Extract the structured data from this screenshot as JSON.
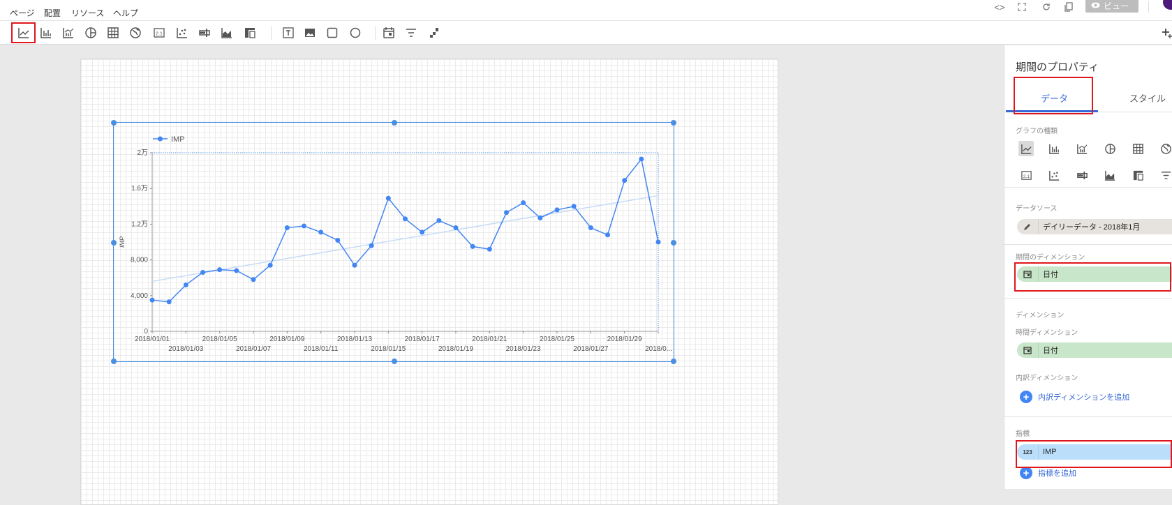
{
  "menu": [
    "ページ",
    "配置",
    "リソース",
    "ヘルプ"
  ],
  "top_icons": [
    "code-icon",
    "fullscreen-icon",
    "refresh-icon",
    "copy-icon"
  ],
  "view_button": "ビュー",
  "toolbar": {
    "chart_tools": [
      "time-series-icon",
      "bar-chart-icon",
      "combo-chart-icon",
      "pie-chart-icon",
      "table-icon",
      "geo-map-icon",
      "scorecard-icon",
      "scatter-icon",
      "bullet-icon",
      "area-chart-icon",
      "pivot-icon"
    ],
    "insert_tools": [
      "text-icon",
      "image-icon",
      "rectangle-icon",
      "circle-icon"
    ],
    "control_tools": [
      "date-range-icon",
      "filter-icon",
      "data-control-icon"
    ],
    "selected": "time-series-icon"
  },
  "chart_data": {
    "type": "line",
    "title": "",
    "legend": "IMP",
    "legend_position": "top-left",
    "ylabel": "IMP",
    "xlabel": "",
    "ylim": [
      0,
      20000
    ],
    "y_ticks": [
      "0",
      "4,000",
      "8,000",
      "1.2万",
      "1.6万",
      "2万"
    ],
    "x_ticks_row1": [
      "2018/01/01",
      "2018/01/05",
      "2018/01/09",
      "2018/01/13",
      "2018/01/17",
      "2018/01/21",
      "2018/01/25",
      "2018/01/29"
    ],
    "x_ticks_row2": [
      "2018/01/03",
      "2018/01/07",
      "2018/01/11",
      "2018/01/15",
      "2018/01/19",
      "2018/01/23",
      "2018/01/27",
      "2018/0..."
    ],
    "x": [
      "2018/01/01",
      "2018/01/02",
      "2018/01/03",
      "2018/01/04",
      "2018/01/05",
      "2018/01/06",
      "2018/01/07",
      "2018/01/08",
      "2018/01/09",
      "2018/01/10",
      "2018/01/11",
      "2018/01/12",
      "2018/01/13",
      "2018/01/14",
      "2018/01/15",
      "2018/01/16",
      "2018/01/17",
      "2018/01/18",
      "2018/01/19",
      "2018/01/20",
      "2018/01/21",
      "2018/01/22",
      "2018/01/23",
      "2018/01/24",
      "2018/01/25",
      "2018/01/26",
      "2018/01/27",
      "2018/01/28",
      "2018/01/29",
      "2018/01/30",
      "2018/01/31"
    ],
    "series": [
      {
        "name": "IMP",
        "color": "#4285f4",
        "values": [
          3500,
          3300,
          5200,
          6600,
          6900,
          6800,
          5800,
          7400,
          11600,
          11800,
          11100,
          10200,
          7400,
          9600,
          14900,
          12600,
          11100,
          12400,
          11600,
          9500,
          9200,
          13300,
          14400,
          12700,
          13600,
          14000,
          11600,
          10800,
          16900,
          19300,
          10000
        ]
      }
    ],
    "trendline": {
      "start": 5600,
      "end": 15200,
      "color": "#c6dbf7"
    },
    "grid": true
  },
  "panel": {
    "title": "期間のプロパティ",
    "tabs": [
      "データ",
      "スタイル"
    ],
    "chart_type_label": "グラフの種類",
    "chart_types_row1": [
      "time-series-icon",
      "bar-chart-icon",
      "combo-chart-icon",
      "pie-chart-icon",
      "table-icon",
      "geo-map-icon"
    ],
    "chart_types_row2": [
      "scorecard-icon",
      "scatter-icon",
      "bullet-icon",
      "area-chart-icon",
      "pivot-icon",
      "filter-icon"
    ],
    "datasource_label": "データソース",
    "datasource": "デイリーデータ - 2018年1月",
    "period_dim_label": "期間のディメンション",
    "period_dim": "日付",
    "dimension_label": "ディメンション",
    "time_dim_label": "時間ディメンション",
    "time_dim": "日付",
    "breakdown_label": "内訳ディメンション",
    "add_breakdown": "内訳ディメンションを追加",
    "metric_label": "指標",
    "metric_type": "123",
    "metric": "IMP",
    "add_metric": "指標を追加"
  },
  "colors": {
    "accent": "#3367d6",
    "highlight": "#e0161d",
    "selection": "#4a90e2"
  }
}
